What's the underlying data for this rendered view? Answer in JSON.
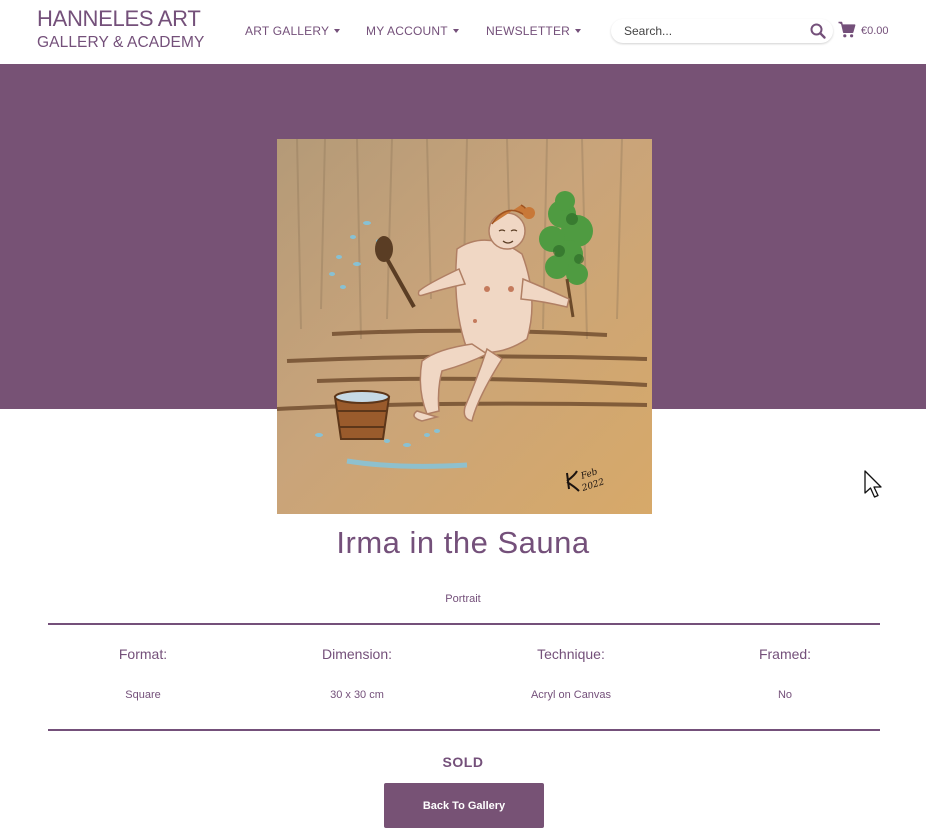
{
  "header": {
    "logo_line1": "HANNELES ART",
    "logo_line2": "GALLERY & ACADEMY",
    "nav": [
      {
        "label": "ART GALLERY"
      },
      {
        "label": "MY ACCOUNT"
      },
      {
        "label": "NEWSLETTER"
      }
    ],
    "search_placeholder": "Search...",
    "cart_total": "€0.00"
  },
  "product": {
    "title": "Irma in the Sauna",
    "category": "Portrait",
    "specs": [
      {
        "label": "Format:",
        "value": "Square"
      },
      {
        "label": "Dimension:",
        "value": "30 x 30 cm"
      },
      {
        "label": "Technique:",
        "value": "Acryl on Canvas"
      },
      {
        "label": "Framed:",
        "value": "No"
      }
    ],
    "signature": "K. Feb 2022",
    "status": "SOLD",
    "back_label": "Back To Gallery"
  },
  "colors": {
    "brand": "#74507a",
    "hero_bg": "#775275"
  }
}
